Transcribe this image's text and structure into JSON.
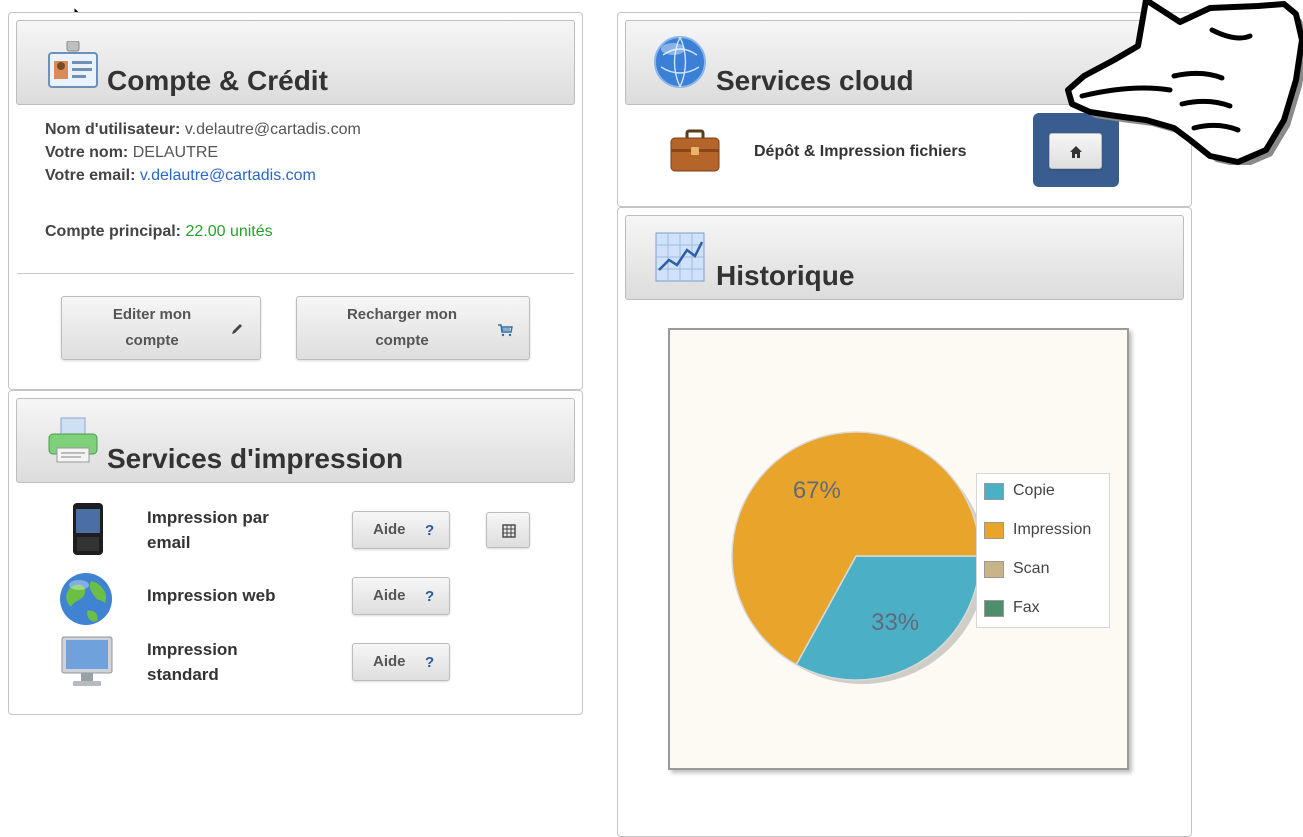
{
  "account": {
    "title": "Compte & Crédit",
    "username_label": "Nom d'utilisateur:",
    "username_value": "v.delautre@cartadis.com",
    "name_label": "Votre nom:",
    "name_value": "DELAUTRE",
    "email_label": "Votre email:",
    "email_value": "v.delautre@cartadis.com",
    "main_account_label": "Compte principal:",
    "main_account_value": "22.00 unités",
    "edit_button_line1": "Editer mon",
    "edit_button_line2": "compte",
    "reload_button_line1": "Recharger mon",
    "reload_button_line2": "compte"
  },
  "print_services": {
    "title": "Services d'impression",
    "items": [
      {
        "label_line1": "Impression par",
        "label_line2": "email",
        "help_label": "Aide",
        "help_icon": "?"
      },
      {
        "label_line1": "Impression web",
        "label_line2": "",
        "help_label": "Aide",
        "help_icon": "?"
      },
      {
        "label_line1": "Impression",
        "label_line2": "standard",
        "help_label": "Aide",
        "help_icon": "?"
      }
    ]
  },
  "cloud": {
    "title": "Services cloud",
    "deposit_label": "Dépôt & Impression fichiers"
  },
  "history": {
    "title": "Historique"
  },
  "chart_data": {
    "type": "pie",
    "slices": [
      {
        "label": "Copie",
        "value": 33,
        "color": "#4bb0c6",
        "display": "33%"
      },
      {
        "label": "Impression",
        "value": 67,
        "color": "#e9a42b",
        "display": "67%"
      },
      {
        "label": "Scan",
        "value": 0,
        "color": "#c8b587"
      },
      {
        "label": "Fax",
        "value": 0,
        "color": "#4e8f6b"
      }
    ],
    "legend": [
      "Copie",
      "Impression",
      "Scan",
      "Fax"
    ],
    "legend_position": "right",
    "background": "#fcfaf2"
  },
  "colors": {
    "accent_blue": "#2a67c9",
    "credit_green": "#27a12c",
    "highlight_border": "#3a5d8f"
  }
}
